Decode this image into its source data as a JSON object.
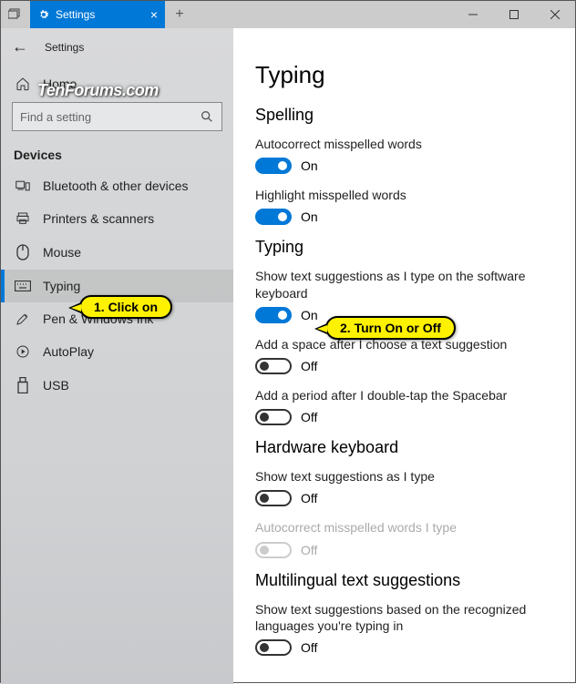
{
  "window": {
    "tab_title": "Settings",
    "app_title": "Settings"
  },
  "sidebar": {
    "home": "Home",
    "search_placeholder": "Find a setting",
    "category": "Devices",
    "items": [
      {
        "label": "Bluetooth & other devices"
      },
      {
        "label": "Printers & scanners"
      },
      {
        "label": "Mouse"
      },
      {
        "label": "Typing"
      },
      {
        "label": "Pen & Windows Ink"
      },
      {
        "label": "AutoPlay"
      },
      {
        "label": "USB"
      }
    ]
  },
  "watermark": "TenForums.com",
  "content": {
    "title": "Typing",
    "sections": [
      {
        "heading": "Spelling",
        "settings": [
          {
            "label": "Autocorrect misspelled words",
            "state": "On",
            "on": true,
            "disabled": false
          },
          {
            "label": "Highlight misspelled words",
            "state": "On",
            "on": true,
            "disabled": false
          }
        ]
      },
      {
        "heading": "Typing",
        "settings": [
          {
            "label": "Show text suggestions as I type on the software keyboard",
            "state": "On",
            "on": true,
            "disabled": false
          },
          {
            "label": "Add a space after I choose a text suggestion",
            "state": "Off",
            "on": false,
            "disabled": false
          },
          {
            "label": "Add a period after I double-tap the Spacebar",
            "state": "Off",
            "on": false,
            "disabled": false
          }
        ]
      },
      {
        "heading": "Hardware keyboard",
        "settings": [
          {
            "label": "Show text suggestions as I type",
            "state": "Off",
            "on": false,
            "disabled": false
          },
          {
            "label": "Autocorrect misspelled words I type",
            "state": "Off",
            "on": false,
            "disabled": true
          }
        ]
      },
      {
        "heading": "Multilingual text suggestions",
        "settings": [
          {
            "label": "Show text suggestions based on the recognized languages you're typing in",
            "state": "Off",
            "on": false,
            "disabled": false
          }
        ]
      }
    ]
  },
  "callouts": {
    "c1": "1. Click on",
    "c2": "2. Turn On or Off"
  }
}
